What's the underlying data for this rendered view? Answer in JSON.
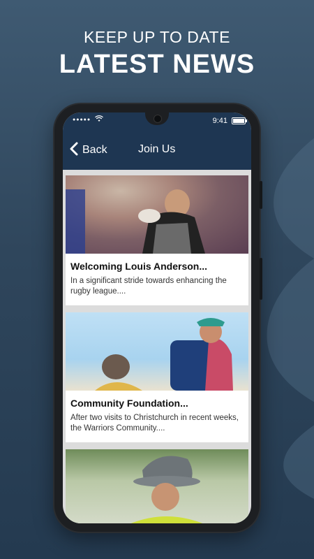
{
  "promo": {
    "line1": "KEEP UP TO DATE",
    "line2": "LATEST NEWS"
  },
  "status_bar": {
    "signal": "●●●●●",
    "time": "9:41"
  },
  "nav": {
    "back_label": "Back",
    "title": "Join Us"
  },
  "articles": [
    {
      "title": "Welcoming Louis Anderson...",
      "excerpt": "In a significant stride towards enhancing the rugby league...."
    },
    {
      "title": "Community Foundation...",
      "excerpt": "After two visits to Christchurch in recent weeks, the Warriors Community...."
    }
  ],
  "colors": {
    "background": "#2f465c",
    "navbar": "#1e3652",
    "card": "#ffffff"
  }
}
